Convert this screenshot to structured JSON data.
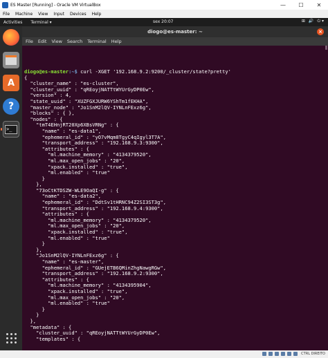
{
  "vbox": {
    "title": "ES Master [Running] - Oracle VM VirtualBox",
    "menu": [
      "File",
      "Machine",
      "View",
      "Input",
      "Devices",
      "Help"
    ],
    "controls": {
      "minimize": "—",
      "maximize": "☐",
      "close": "✕"
    }
  },
  "ubuntu": {
    "activities": "Activities",
    "app_menu": "Terminal ▾",
    "clock": "sex 20:07",
    "tray": [
      "⊞",
      "🔊",
      "⏻ ▾"
    ]
  },
  "terminal": {
    "title": "diogo@es-master: ~",
    "close": "×",
    "menu": [
      "File",
      "Edit",
      "View",
      "Search",
      "Terminal",
      "Help"
    ],
    "prompt_user": "diogo@es-master",
    "prompt_path": ":~$",
    "command": " curl -XGET '192.168.9.2:9200/_cluster/state?pretty'",
    "output": [
      "{",
      "  \"cluster_name\" : \"es-cluster\",",
      "  \"cluster_uuid\" : \"qREoyjNATTtWYUrGyDP0Ew\",",
      "  \"version\" : 4,",
      "  \"state_uuid\" : \"XUZFGXJURW6YShTm1fEKHA\",",
      "  \"master_node\" : \"Jo1SnM2lQV-IYNLnFExz6g\",",
      "  \"blocks\" : { },",
      "  \"nodes\" : {",
      "    \"tmT4EHnjRT20Xp6XBsVRNg\" : {",
      "      \"name\" : \"es-data1\",",
      "      \"ephemeral_id\" : \"yO7vMqm8TgyC4qIgyl3T7A\",",
      "      \"transport_address\" : \"192.168.9.3:9300\",",
      "      \"attributes\" : {",
      "        \"ml.machine_memory\" : \"4134379520\",",
      "        \"ml.max_open_jobs\" : \"20\",",
      "        \"xpack.installed\" : \"true\",",
      "        \"ml.enabled\" : \"true\"",
      "      }",
      "    },",
      "    \"73oCtKTDSZW-WLE9OaQI-g\" : {",
      "      \"name\" : \"es-data2\",",
      "      \"ephemeral_id\" : \"DdtSv1tHRNC94Z2SI3ST3g\",",
      "      \"transport_address\" : \"192.168.9.4:9300\",",
      "      \"attributes\" : {",
      "        \"ml.machine_memory\" : \"4134379520\",",
      "        \"ml.max_open_jobs\" : \"20\",",
      "        \"xpack.installed\" : \"true\",",
      "        \"ml.enabled\" : \"true\"",
      "      }",
      "    },",
      "    \"Jo1SnM2lQV-IYNLnFExz6g\" : {",
      "      \"name\" : \"es-master\",",
      "      \"ephemeral_id\" : \"GUejETB6QMinZhgNawgRGw\",",
      "      \"transport_address\" : \"192.168.9.2:9300\",",
      "      \"attributes\" : {",
      "        \"ml.machine_memory\" : \"4134395904\",",
      "        \"xpack.installed\" : \"true\",",
      "        \"ml.max_open_jobs\" : \"20\",",
      "        \"ml.enabled\" : \"true\"",
      "      }",
      "    }",
      "  },",
      "  \"metadata\" : {",
      "    \"cluster_uuid\" : \"qREoyjNATTtWYUrGyDP0Ew\",",
      "    \"templates\" : {"
    ]
  },
  "taskbar": {
    "ctrl_label": "CTRL DIREITO"
  }
}
